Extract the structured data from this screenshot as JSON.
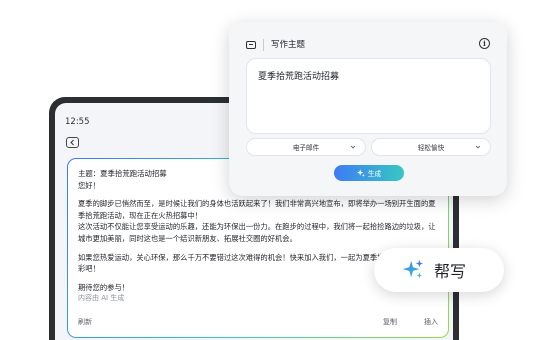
{
  "tablet": {
    "status_time": "12:55"
  },
  "email_card": {
    "subject": "主题：夏季拾荒跑活动招募",
    "greeting": "您好！",
    "body_1": "夏季的脚步已悄然而至，是时候让我们的身体也活跃起来了！我们非常高兴地宣布，即将举办一场别开生面的夏季拾荒跑活动，现在正在火热招募中！",
    "body_2": "这次活动不仅能让您享受运动的乐趣，还能为环保出一份力。在跑步的过程中，我们将一起拾捡路边的垃圾，让城市更加美丽，同时这也是一个结识新朋友、拓展社交圈的好机会。",
    "body_3": "如果您热爱运动，关心环保，那么千万不要错过这次难得的机会！快来加入我们，一起为夏季增添一抹活力和色彩吧！",
    "closing": "期待您的参与！",
    "ai_note": "内容由 AI 生成",
    "actions": {
      "refresh": "刷新",
      "copy": "复制",
      "insert": "插入"
    }
  },
  "write_panel": {
    "title": "写作主题",
    "prompt_value": "夏季拾荒跑活动招募",
    "type_option": "电子邮件",
    "tone_option": "轻松愉快",
    "generate_label": "生成",
    "accent_start": "#3d7bf5",
    "accent_end": "#37c8c2"
  },
  "help_write": {
    "label": "帮写",
    "icon": "sparkle-icon"
  }
}
